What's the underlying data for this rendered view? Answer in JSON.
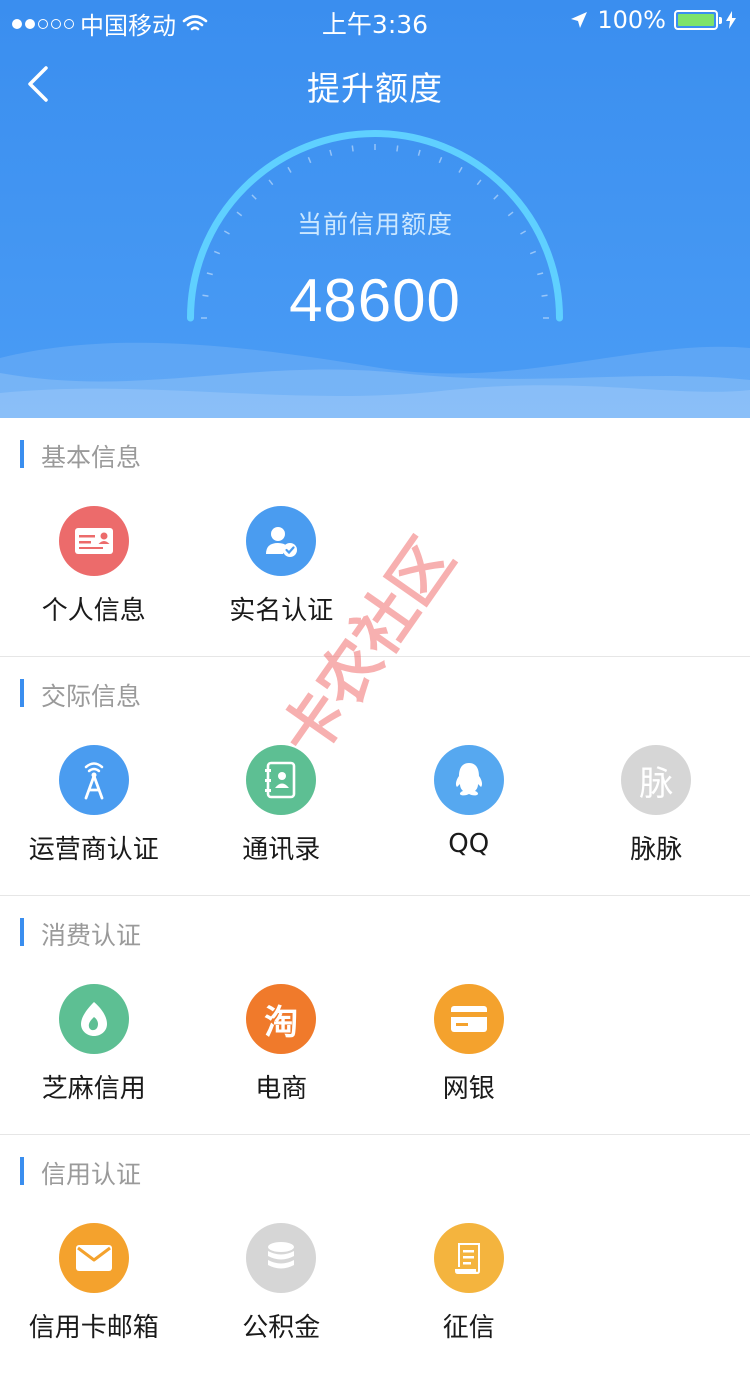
{
  "status_bar": {
    "carrier": "中国移动",
    "time": "上午3:36",
    "battery": "100%"
  },
  "nav": {
    "title": "提升额度"
  },
  "credit": {
    "label": "当前信用额度",
    "amount": "48600"
  },
  "sections": [
    {
      "title": "基本信息",
      "items": [
        {
          "label": "个人信息",
          "icon": "id-card-icon",
          "color": "#ec6b6b"
        },
        {
          "label": "实名认证",
          "icon": "user-verified-icon",
          "color": "#4a9cf0"
        }
      ]
    },
    {
      "title": "交际信息",
      "items": [
        {
          "label": "运营商认证",
          "icon": "signal-tower-icon",
          "color": "#4a9cf0"
        },
        {
          "label": "通讯录",
          "icon": "contacts-book-icon",
          "color": "#5dbf93"
        },
        {
          "label": "QQ",
          "icon": "qq-penguin-icon",
          "color": "#56a8f0"
        },
        {
          "label": "脉脉",
          "icon": "maimai-icon",
          "icon_text": "脉",
          "color": "#d6d6d6"
        }
      ]
    },
    {
      "title": "消费认证",
      "items": [
        {
          "label": "芝麻信用",
          "icon": "sesame-icon",
          "color": "#5dbf93"
        },
        {
          "label": "电商",
          "icon": "taobao-icon",
          "icon_text": "淘",
          "color": "#f07a2b"
        },
        {
          "label": "网银",
          "icon": "bank-card-icon",
          "color": "#f4a22d"
        }
      ]
    },
    {
      "title": "信用认证",
      "items": [
        {
          "label": "信用卡邮箱",
          "icon": "mail-icon",
          "color": "#f4a22d"
        },
        {
          "label": "公积金",
          "icon": "coin-stack-icon",
          "color": "#d6d6d6"
        },
        {
          "label": "征信",
          "icon": "document-icon",
          "color": "#f4b43e"
        }
      ]
    }
  ],
  "watermark": {
    "text": "卡农社区",
    "color": "#f07070"
  }
}
